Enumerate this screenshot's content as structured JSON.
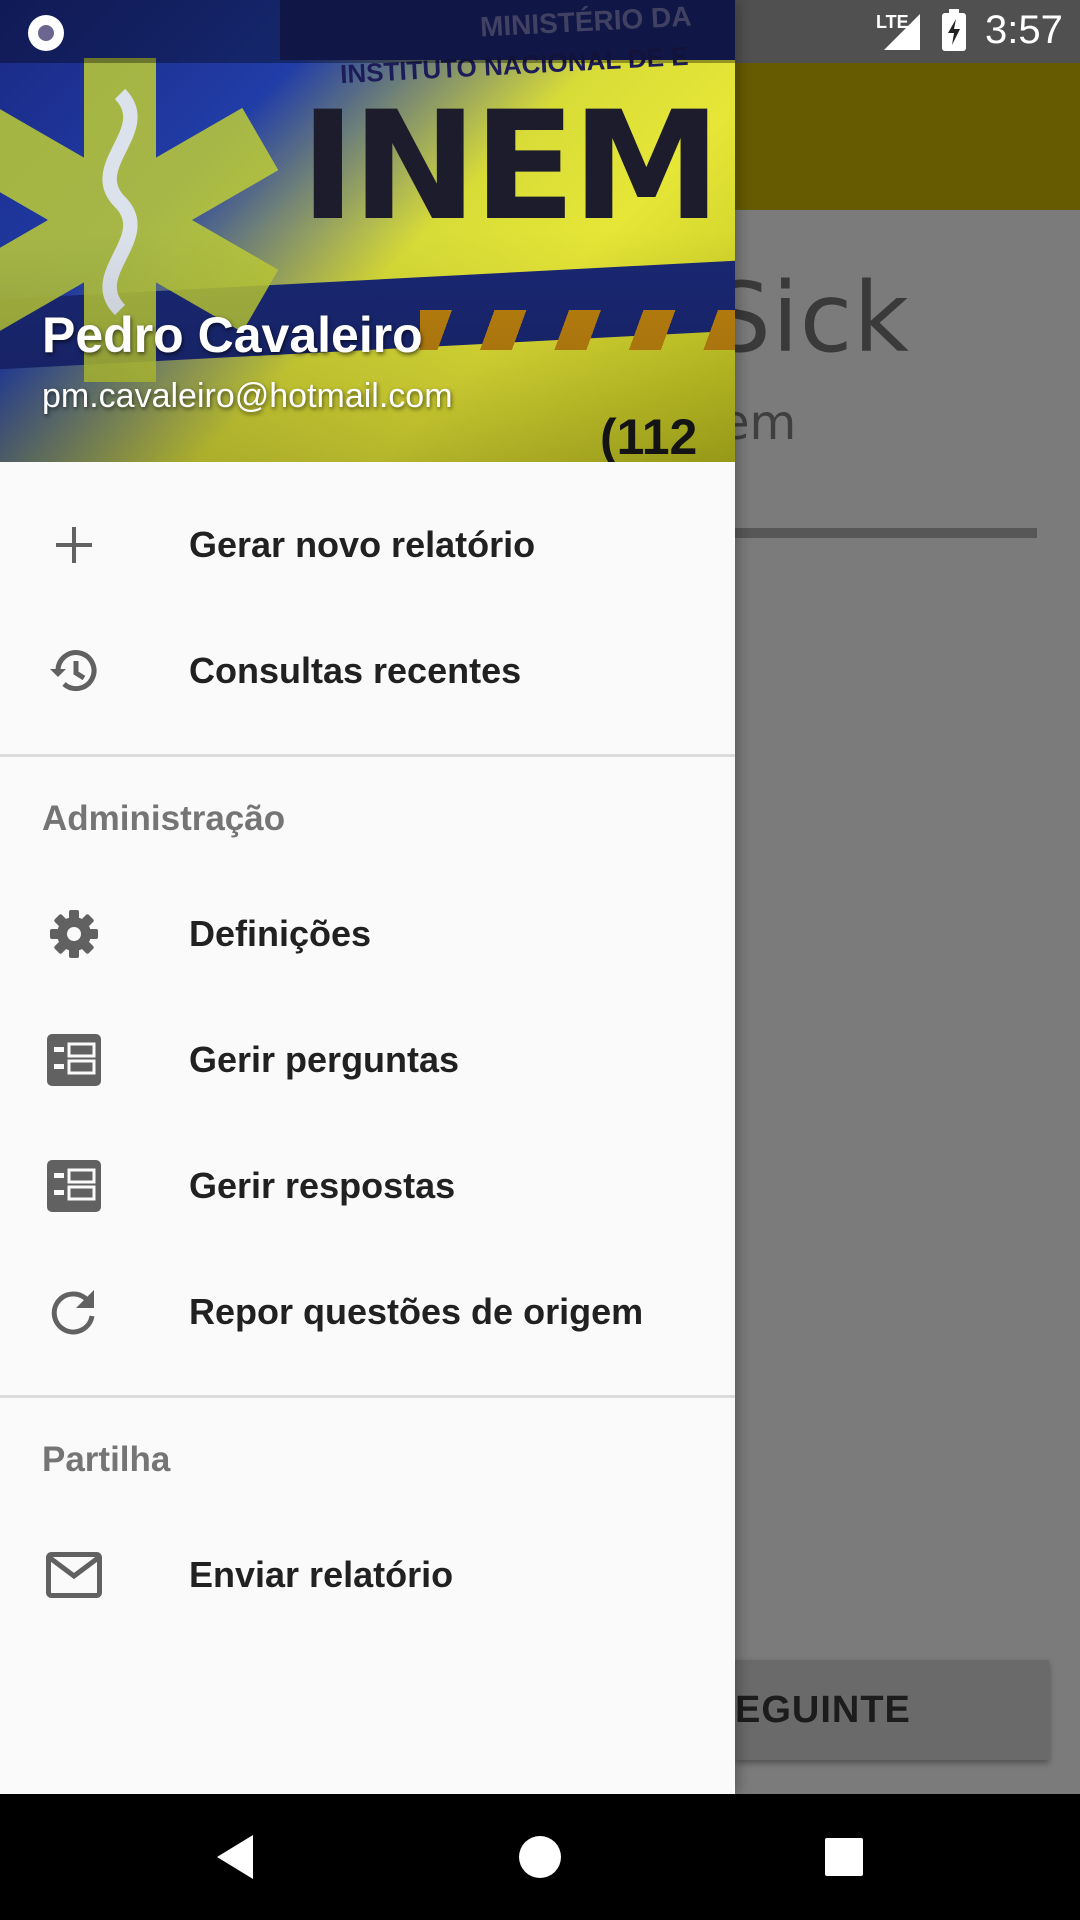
{
  "status_bar": {
    "network": "LTE",
    "time": "3:57"
  },
  "background_app": {
    "title_fragment": "Sick",
    "subtitle_fragment": "em",
    "next_button_fragment": "EGUINTE"
  },
  "drawer": {
    "header": {
      "user_name": "Pedro Cavaleiro",
      "user_email": "pm.cavaleiro@hotmail.com"
    },
    "items": [
      {
        "label": "Gerar novo relatório",
        "icon": "add-icon"
      },
      {
        "label": "Consultas recentes",
        "icon": "history-icon"
      }
    ],
    "sections": [
      {
        "title": "Administração",
        "items": [
          {
            "label": "Definições",
            "icon": "gear-icon"
          },
          {
            "label": "Gerir perguntas",
            "icon": "list-icon"
          },
          {
            "label": "Gerir respostas",
            "icon": "list-icon"
          },
          {
            "label": "Repor questões de origem",
            "icon": "refresh-icon"
          }
        ]
      },
      {
        "title": "Partilha",
        "items": [
          {
            "label": "Enviar relatório",
            "icon": "mail-icon"
          }
        ]
      }
    ]
  },
  "colors": {
    "toolbar_accent": "#665b00",
    "drawer_bg": "#fafafa",
    "icon_color": "#616161"
  }
}
